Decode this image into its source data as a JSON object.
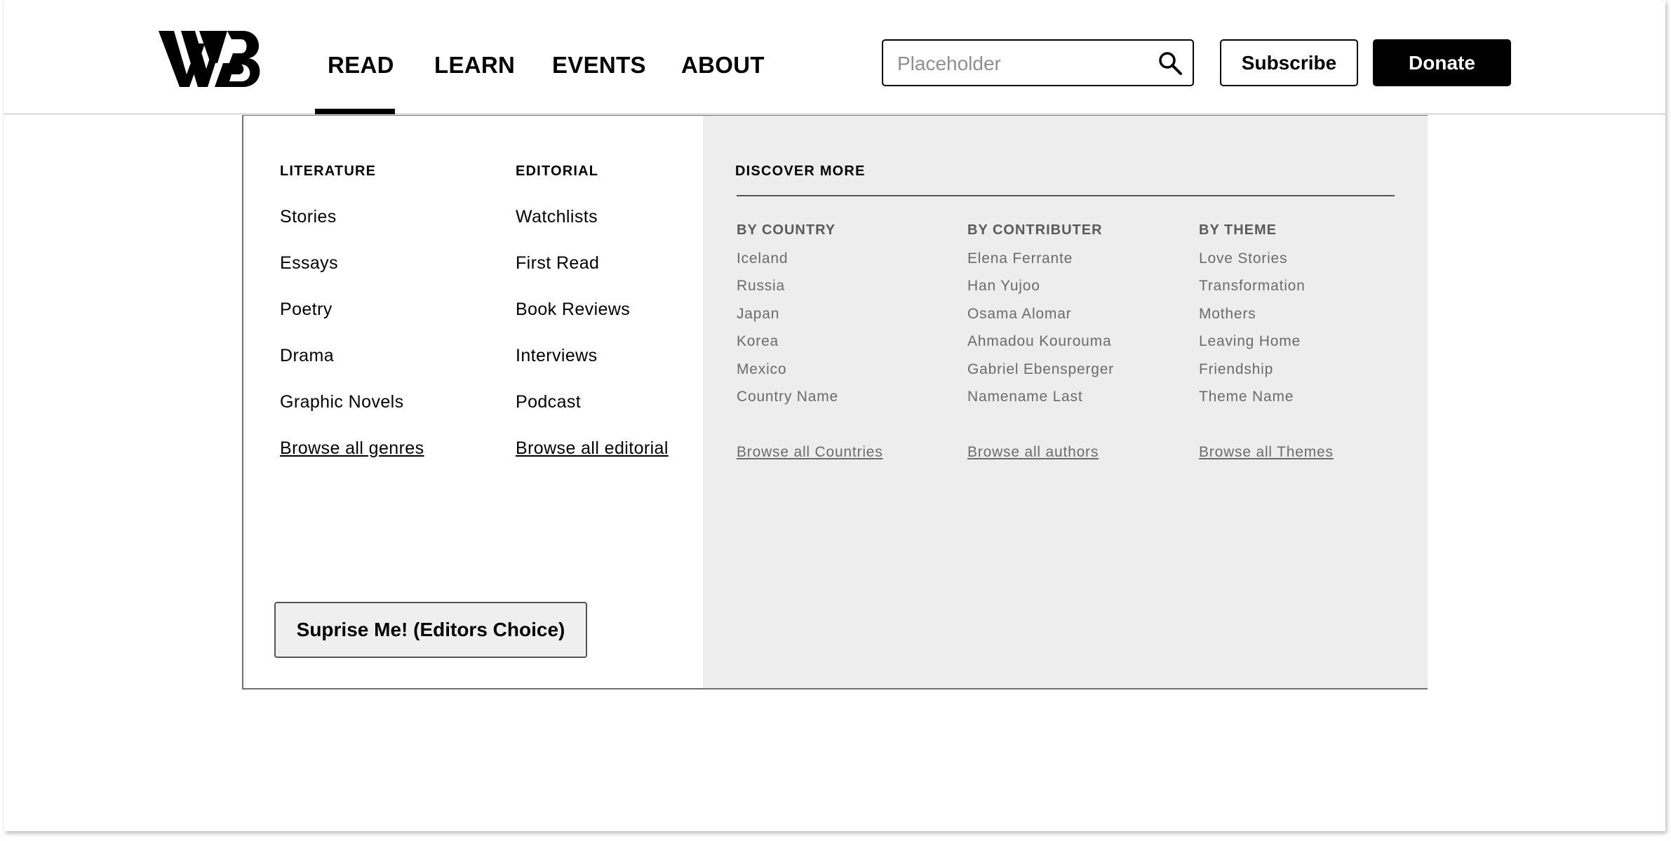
{
  "nav": {
    "items": [
      {
        "label": "READ",
        "active": true
      },
      {
        "label": "LEARN"
      },
      {
        "label": "EVENTS"
      },
      {
        "label": "ABOUT"
      }
    ]
  },
  "search": {
    "placeholder": "Placeholder",
    "value": "",
    "icon": "search-icon"
  },
  "actions": {
    "subscribe_label": "Subscribe",
    "donate_label": "Donate"
  },
  "menu": {
    "literature": {
      "heading": "LITERATURE",
      "items": [
        "Stories",
        "Essays",
        "Poetry",
        "Drama",
        "Graphic Novels"
      ],
      "browse": "Browse all genres"
    },
    "editorial": {
      "heading": "EDITORIAL",
      "items": [
        "Watchlists",
        "First Read",
        "Book Reviews",
        "Interviews",
        "Podcast"
      ],
      "browse": "Browse all editorial"
    },
    "surprise_label": "Suprise Me! (Editors Choice)",
    "discover": {
      "heading": "DISCOVER MORE",
      "by_country": {
        "heading": "BY COUNTRY",
        "items": [
          "Iceland",
          "Russia",
          "Japan",
          "Korea",
          "Mexico",
          "Country Name"
        ],
        "browse": "Browse all Countries"
      },
      "by_contributor": {
        "heading": "BY CONTRIBUTER",
        "items": [
          "Elena Ferrante",
          "Han Yujoo",
          "Osama Alomar",
          "Ahmadou Kourouma",
          "Gabriel Ebensperger",
          "Namename Last"
        ],
        "browse": "Browse all authors"
      },
      "by_theme": {
        "heading": "BY THEME",
        "items": [
          "Love Stories",
          "Transformation",
          "Mothers",
          "Leaving Home",
          "Friendship",
          "Theme Name"
        ],
        "browse": "Browse all Themes"
      }
    }
  },
  "colors": {
    "accent": "#000000",
    "panel_bg": "#ededed",
    "muted_text": "#6b6b6b"
  }
}
